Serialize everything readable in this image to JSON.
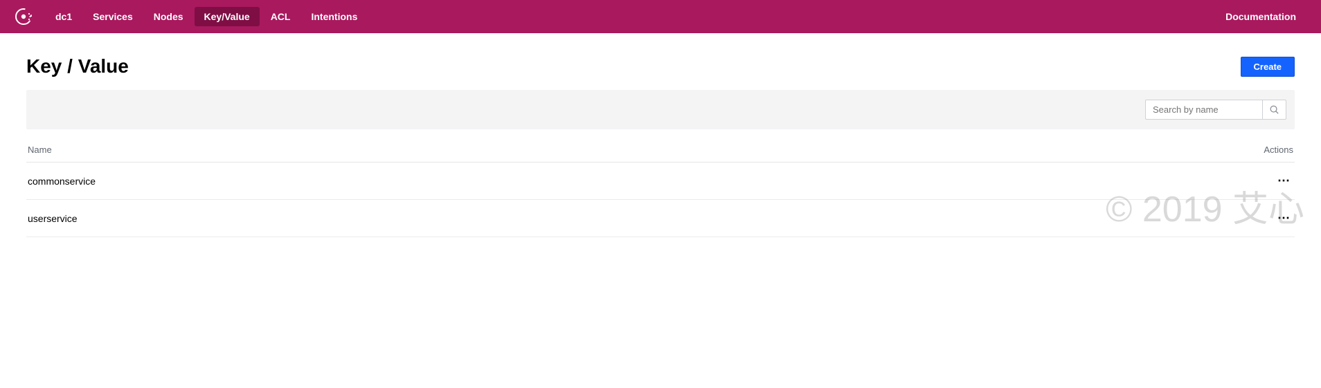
{
  "nav": {
    "datacenter": "dc1",
    "items": [
      {
        "label": "Services",
        "active": false
      },
      {
        "label": "Nodes",
        "active": false
      },
      {
        "label": "Key/Value",
        "active": true
      },
      {
        "label": "ACL",
        "active": false
      },
      {
        "label": "Intentions",
        "active": false
      }
    ],
    "documentation": "Documentation"
  },
  "page": {
    "title": "Key / Value",
    "create_label": "Create",
    "search_placeholder": "Search by name"
  },
  "table": {
    "col_name": "Name",
    "col_actions": "Actions",
    "rows": [
      {
        "name": "commonservice"
      },
      {
        "name": "userservice"
      }
    ]
  },
  "watermark": "© 2019 艾心"
}
